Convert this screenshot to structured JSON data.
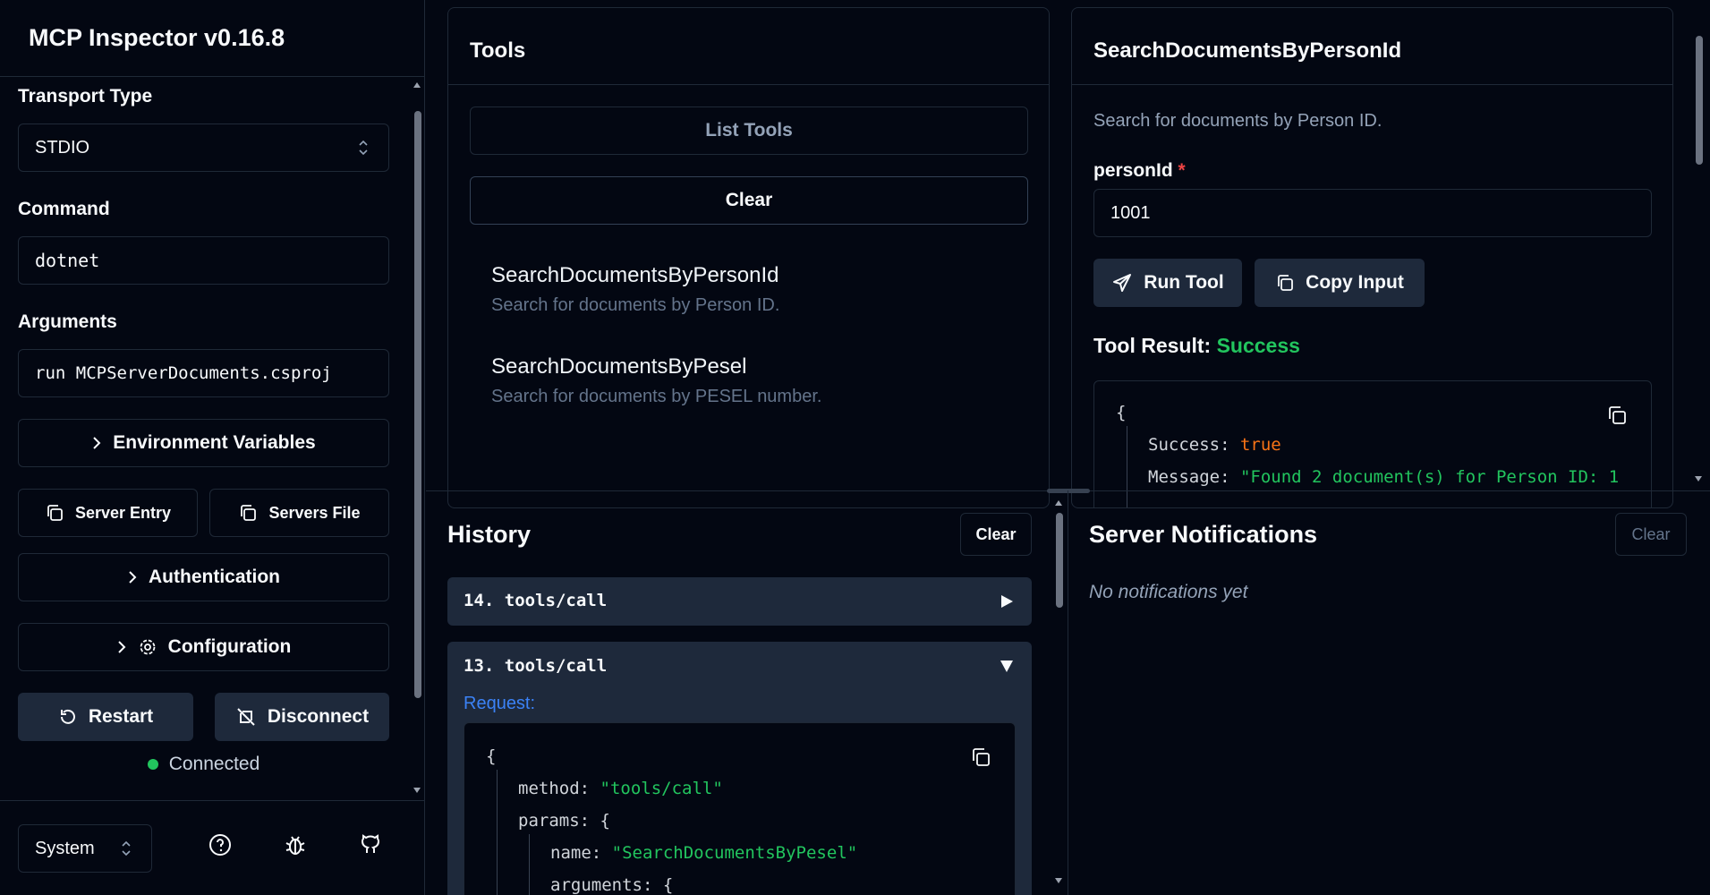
{
  "app": {
    "title": "MCP Inspector v0.16.8"
  },
  "sidebar": {
    "transport_label": "Transport Type",
    "transport_value": "STDIO",
    "command_label": "Command",
    "command_value": "dotnet",
    "arguments_label": "Arguments",
    "arguments_value": "run MCPServerDocuments.csproj",
    "env_vars_label": "Environment Variables",
    "server_entry_label": "Server Entry",
    "servers_file_label": "Servers File",
    "authentication_label": "Authentication",
    "configuration_label": "Configuration",
    "restart_label": "Restart",
    "disconnect_label": "Disconnect",
    "status_text": "Connected",
    "theme_value": "System"
  },
  "tools": {
    "title": "Tools",
    "list_tools_label": "List Tools",
    "clear_label": "Clear",
    "items": [
      {
        "name": "SearchDocumentsByPersonId",
        "description": "Search for documents by Person ID."
      },
      {
        "name": "SearchDocumentsByPesel",
        "description": "Search for documents by PESEL number."
      }
    ]
  },
  "tool_detail": {
    "title": "SearchDocumentsByPersonId",
    "description": "Search for documents by Person ID.",
    "param_label": "personId",
    "param_required": "*",
    "param_value": "1001",
    "run_label": "Run Tool",
    "copy_label": "Copy Input",
    "result_label": "Tool Result:",
    "result_status": "Success",
    "result_lines": {
      "open": "{",
      "k1": "Success:",
      "v1": "true",
      "k2": "Message:",
      "v2": "\"Found 2 document(s) for Person ID: 1"
    }
  },
  "history": {
    "title": "History",
    "clear_label": "Clear",
    "entries": [
      {
        "label": "14. tools/call"
      },
      {
        "label": "13. tools/call"
      }
    ],
    "request_label": "Request:",
    "code": {
      "open": "{",
      "k_method": "method:",
      "v_method": "\"tools/call\"",
      "k_params": "params:",
      "v_params_open": "{",
      "k_name": "name:",
      "v_name": "\"SearchDocumentsByPesel\"",
      "k_args": "arguments:",
      "v_args_open": "{"
    }
  },
  "notifications": {
    "title": "Server Notifications",
    "clear_label": "Clear",
    "empty_text": "No notifications yet"
  },
  "colors": {
    "success": "#22c55e",
    "request": "#3b82f6",
    "required": "#ef4444"
  }
}
